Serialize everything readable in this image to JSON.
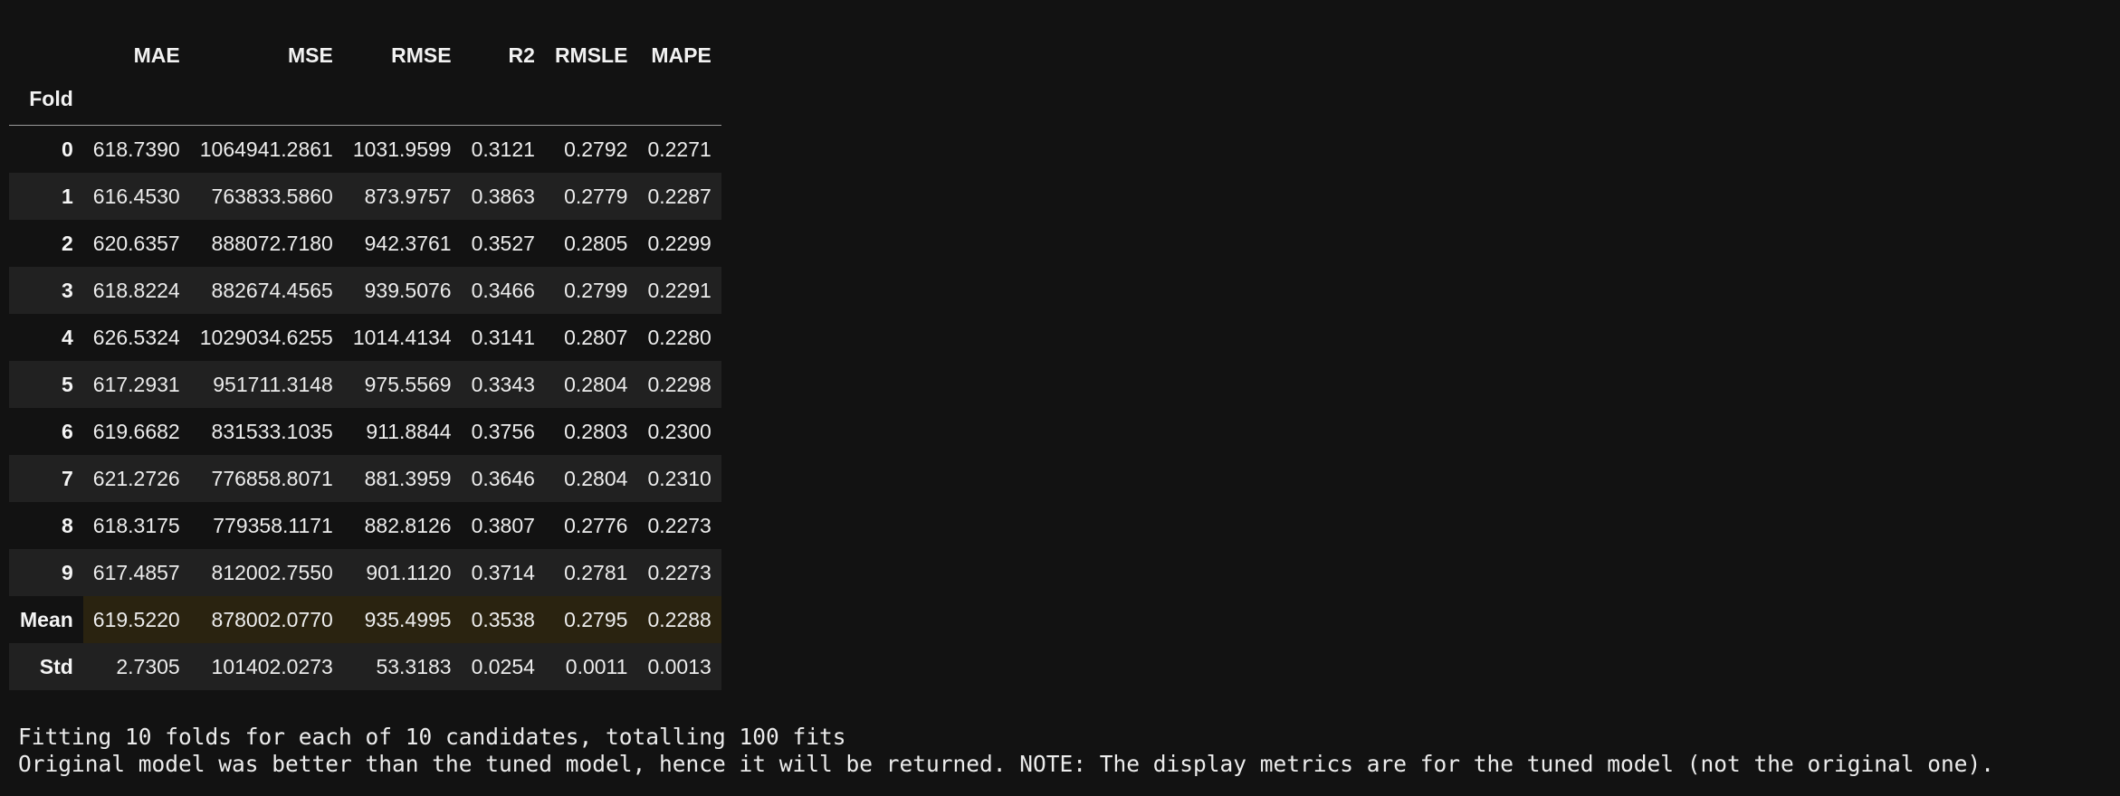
{
  "table": {
    "columns": [
      "MAE",
      "MSE",
      "RMSE",
      "R2",
      "RMSLE",
      "MAPE"
    ],
    "index_name": "Fold",
    "rows": [
      {
        "label": "0",
        "values": [
          "618.7390",
          "1064941.2861",
          "1031.9599",
          "0.3121",
          "0.2792",
          "0.2271"
        ]
      },
      {
        "label": "1",
        "values": [
          "616.4530",
          "763833.5860",
          "873.9757",
          "0.3863",
          "0.2779",
          "0.2287"
        ]
      },
      {
        "label": "2",
        "values": [
          "620.6357",
          "888072.7180",
          "942.3761",
          "0.3527",
          "0.2805",
          "0.2299"
        ]
      },
      {
        "label": "3",
        "values": [
          "618.8224",
          "882674.4565",
          "939.5076",
          "0.3466",
          "0.2799",
          "0.2291"
        ]
      },
      {
        "label": "4",
        "values": [
          "626.5324",
          "1029034.6255",
          "1014.4134",
          "0.3141",
          "0.2807",
          "0.2280"
        ]
      },
      {
        "label": "5",
        "values": [
          "617.2931",
          "951711.3148",
          "975.5569",
          "0.3343",
          "0.2804",
          "0.2298"
        ]
      },
      {
        "label": "6",
        "values": [
          "619.6682",
          "831533.1035",
          "911.8844",
          "0.3756",
          "0.2803",
          "0.2300"
        ]
      },
      {
        "label": "7",
        "values": [
          "621.2726",
          "776858.8071",
          "881.3959",
          "0.3646",
          "0.2804",
          "0.2310"
        ]
      },
      {
        "label": "8",
        "values": [
          "618.3175",
          "779358.1171",
          "882.8126",
          "0.3807",
          "0.2776",
          "0.2273"
        ]
      },
      {
        "label": "9",
        "values": [
          "617.4857",
          "812002.7550",
          "901.1120",
          "0.3714",
          "0.2781",
          "0.2273"
        ]
      },
      {
        "label": "Mean",
        "values": [
          "619.5220",
          "878002.0770",
          "935.4995",
          "0.3538",
          "0.2795",
          "0.2288"
        ]
      },
      {
        "label": "Std",
        "values": [
          "2.7305",
          "101402.0273",
          "53.3183",
          "0.0254",
          "0.0011",
          "0.0013"
        ]
      }
    ],
    "highlight_row": "Mean",
    "highlight_color": "#2a2310"
  },
  "log": {
    "line1": "Fitting 10 folds for each of 10 candidates, totalling 100 fits",
    "line2": "Original model was better than the tuned model, hence it will be returned. NOTE: The display metrics are for the tuned model (not the original one)."
  }
}
